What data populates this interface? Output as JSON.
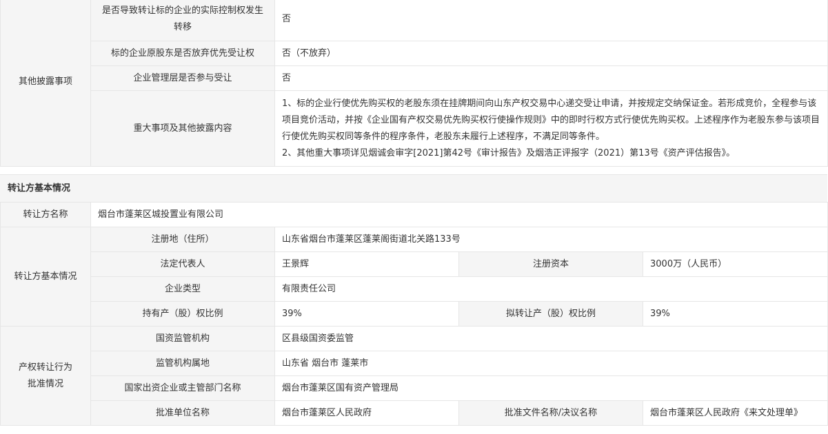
{
  "other_disclosures": {
    "group_label": "其他披露事项",
    "rows": [
      {
        "label": "是否导致转让标的企业的实际控制权发生转移",
        "value": "否"
      },
      {
        "label": "标的企业原股东是否放弃优先受让权",
        "value": "否（不放弃）"
      },
      {
        "label": "企业管理层是否参与受让",
        "value": "否"
      },
      {
        "label": "重大事项及其他披露内容",
        "lines": [
          "1、标的企业行使优先购买权的老股东须在挂牌期间向山东产权交易中心递交受让申请，并按规定交纳保证金。若形成竞价，全程参与该项目竞价活动，并按《企业国有产权交易优先购买权行使操作规则》中的即时行权方式行使优先购买权。上述程序作为老股东参与该项目行使优先购买权同等条件的程序条件，老股东未履行上述程序，不满足同等条件。",
          "2、其他重大事项详见烟诚会审字[2021]第42号《审计报告》及烟浩正评报字（2021）第13号《资产评估报告》。"
        ]
      }
    ]
  },
  "transferor_section_title": "转让方基本情况",
  "transferor": {
    "name_label": "转让方名称",
    "name_value": "烟台市蓬莱区城投置业有限公司",
    "basic_group_label": "转让方基本情况",
    "address_label": "注册地（住所）",
    "address_value": "山东省烟台市蓬莱区蓬莱阁街道北关路133号",
    "rep_label": "法定代表人",
    "rep_value": "王景辉",
    "capital_label": "注册资本",
    "capital_value": "3000万（人民币）",
    "type_label": "企业类型",
    "type_value": "有限责任公司",
    "hold_label": "持有产（股）权比例",
    "hold_value": "39%",
    "plan_label": "拟转让产（股）权比例",
    "plan_value": "39%"
  },
  "approval": {
    "group_label_line1": "产权转让行为",
    "group_label_line2": "批准情况",
    "regulator_label": "国资监管机构",
    "regulator_value": "区县级国资委监管",
    "location_label": "监管机构属地",
    "location_value": "山东省 烟台市 蓬莱市",
    "dept_label": "国家出资企业或主管部门名称",
    "dept_value": "烟台市蓬莱区国有资产管理局",
    "unit_label": "批准单位名称",
    "unit_value": "烟台市蓬莱区人民政府",
    "doc_label": "批准文件名称/决议名称",
    "doc_value": "烟台市蓬莱区人民政府《来文处理单》"
  }
}
